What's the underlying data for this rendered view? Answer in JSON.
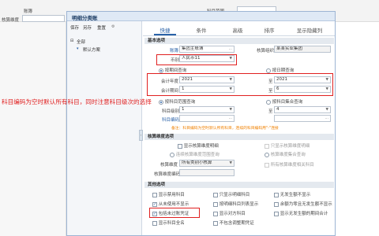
{
  "background": {
    "label_1": "账簿",
    "label_2": "核算维度",
    "label_3": "科目范围"
  },
  "dialog": {
    "title": "明细分类账",
    "toolbar": {
      "save": "保存",
      "save_as": "另存",
      "rename": "重置"
    },
    "tree": {
      "all": "全部",
      "default_scheme": "默认方案"
    },
    "tabs": [
      "快捷",
      "条件",
      "高级",
      "排序",
      "显示隐藏列"
    ],
    "active_tab": "快捷"
  },
  "basic": {
    "section": "基本选项",
    "book_label": "账簿",
    "book_value": "集团主账簿",
    "org_label": "核算组织",
    "org_value": "某某实业集团",
    "currency_label": "币别",
    "currency_value": "人民币11",
    "by_period": "按期间查询",
    "by_date": "按日期查询",
    "year_label": "会计年度",
    "year_from": "2021",
    "to1": "至",
    "year_to": "2021",
    "period_label": "会计期间",
    "period_from": "1",
    "to2": "至",
    "period_to": "6",
    "by_range": "按科目范围查询",
    "by_set": "按科目集合查询",
    "level_label": "科目级别",
    "level_from": "1",
    "to3": "至",
    "level_to": "4",
    "code_label": "科目编码",
    "note": "备注：科目编码为空时默认所有科目，连续的科目编码用\"-\"连接"
  },
  "dimension": {
    "section": "核算维度选项",
    "show_detail": "显示核算维度明细",
    "show_total": "只显示核算维度明细",
    "by_range": "连续核算维度范围查询",
    "by_set": "核算维度集合查询",
    "dim_label": "核算维度",
    "dim_value": "所有类别小核算",
    "code_label": "核算维度编码",
    "detail_accounts": "所有核算维度相关科目"
  },
  "other": {
    "section": "其他选项",
    "items": [
      {
        "label": "显示禁用科目",
        "checked": false
      },
      {
        "label": "只显示明细科目",
        "checked": false
      },
      {
        "label": "无发生额不显示",
        "checked": false
      },
      {
        "label": "从未使用不显示",
        "checked": true
      },
      {
        "label": "按明细科目列表显示",
        "checked": false
      },
      {
        "label": "余额为零且无发生额不显示",
        "checked": false
      },
      {
        "label": "包括未过账凭证",
        "checked": true
      },
      {
        "label": "显示对方科目",
        "checked": false
      },
      {
        "label": "显示无发生额的期间合计",
        "checked": false
      },
      {
        "label": "显示科目全名",
        "checked": false
      },
      {
        "label": "不包含调整期凭证",
        "checked": false
      }
    ]
  },
  "annotation": "科目编码为空时默认所有科目，同时注意科目级次的选择",
  "colors": {
    "annotation": "#e02020",
    "accent": "#2a62a8",
    "note": "#f08000"
  }
}
